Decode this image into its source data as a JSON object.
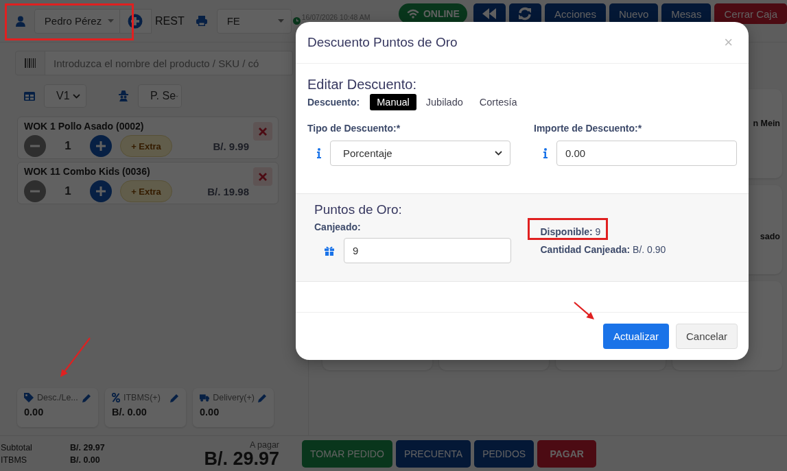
{
  "header": {
    "customer": "Pedro Pérez",
    "mode": "REST",
    "document_type": "FE",
    "timestamp": "16/07/2026 10:48 AM",
    "status": "ONLINE",
    "buttons": [
      {
        "label": "Acciones",
        "kind": "primary"
      },
      {
        "label": "Nuevo",
        "kind": "primary"
      },
      {
        "label": "Mesas",
        "kind": "primary"
      },
      {
        "label": "Cerrar Caja",
        "kind": "danger"
      }
    ]
  },
  "search": {
    "placeholder": "Introduzca el nombre del producto / SKU / có"
  },
  "filters": {
    "table": "V1",
    "waiter": "P. Se"
  },
  "order_items": [
    {
      "name": "WOK 1 Pollo Asado (0002)",
      "quantity": "1",
      "extra": "+ Extra",
      "price": "B/. 9.99"
    },
    {
      "name": "WOK 11 Combo Kids (0036)",
      "quantity": "1",
      "extra": "+ Extra",
      "price": "B/. 19.98"
    }
  ],
  "product_cards": [
    {
      "name": "n Mein"
    },
    {
      "name": "sado"
    }
  ],
  "adjustments": [
    {
      "kind": "discount",
      "label": "Desc./Le...",
      "value": "0.00"
    },
    {
      "kind": "tax",
      "label": "ITBMS(+)",
      "value": "B/. 0.00"
    },
    {
      "kind": "delivery",
      "label": "Delivery(+)",
      "value": "0.00"
    }
  ],
  "totals": {
    "subtotal_label": "Subtotal",
    "subtotal": "B/. 29.97",
    "tax_label": "ITBMS",
    "tax": "B/. 0.00",
    "due_label": "A pagar",
    "due": "B/. 29.97"
  },
  "actions": [
    {
      "label": "TOMAR PEDIDO",
      "kind": "success"
    },
    {
      "label": "PRECUENTA",
      "kind": "primary"
    },
    {
      "label": "PEDIDOS",
      "kind": "primary"
    },
    {
      "label": "PAGAR",
      "kind": "danger"
    }
  ],
  "modal": {
    "title": "Descuento Puntos de Oro",
    "close": "×",
    "section_title": "Editar Descuento:",
    "discount_label": "Descuento:",
    "tabs": [
      {
        "label": "Manual",
        "selected": true
      },
      {
        "label": "Jubilado",
        "selected": false
      },
      {
        "label": "Cortesía",
        "selected": false
      }
    ],
    "type_label": "Tipo de Descuento:*",
    "type_value": "Porcentaje",
    "amount_label": "Importe de Descuento:*",
    "amount_value": "0.00",
    "points_title": "Puntos de Oro:",
    "redeemed_label": "Canjeado:",
    "redeemed_value": "9",
    "available": "**Disponible:** 9",
    "redeemed_amount": "**Cantidad Canjeada:** B/. 0.90",
    "buttons": [
      {
        "label": "Actualizar",
        "kind": "primary"
      },
      {
        "label": "Cancelar",
        "kind": "secondary"
      }
    ]
  }
}
